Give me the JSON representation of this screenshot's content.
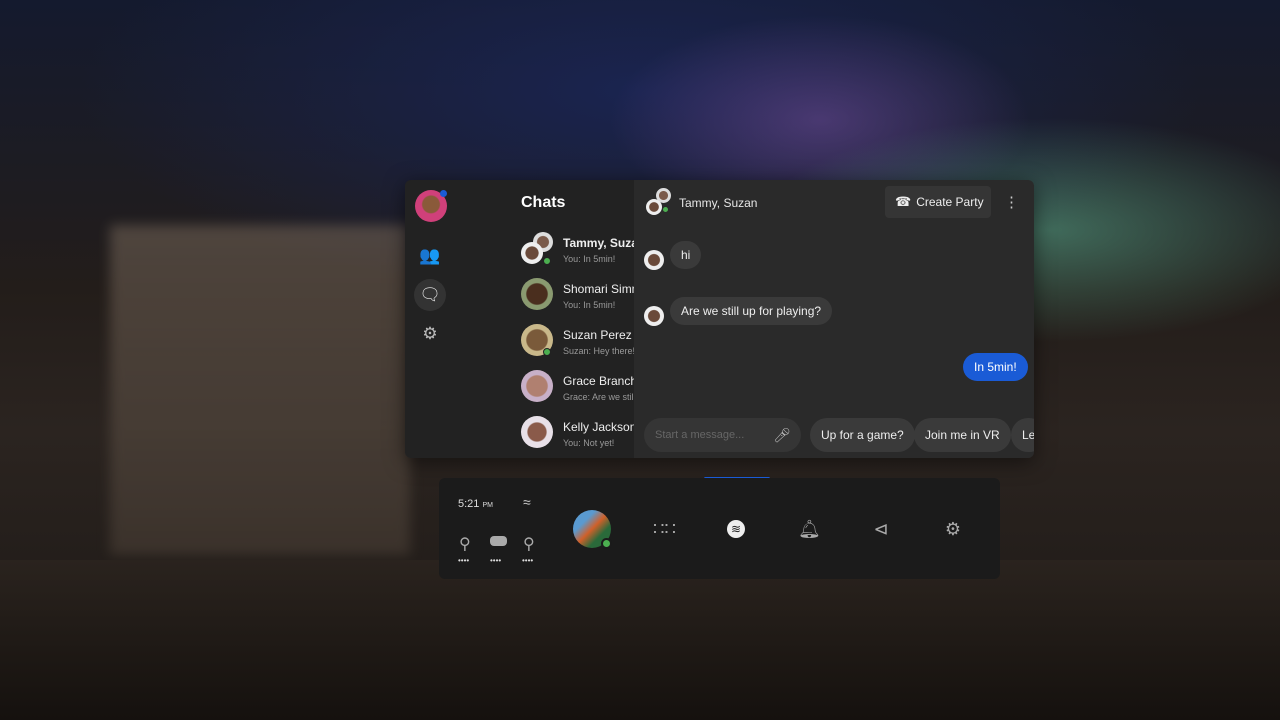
{
  "sidebar": {
    "title": "Chats",
    "icons": [
      "people-icon",
      "chat-icon",
      "gear-icon"
    ]
  },
  "conversations": [
    {
      "name": "Tammy, Suzan",
      "preview": "You: In 5min!",
      "online": true,
      "bold": true
    },
    {
      "name": "Shomari Simm...",
      "preview": "You: In 5min!",
      "online": false
    },
    {
      "name": "Suzan Perez",
      "preview": "Suzan: Hey there!",
      "online": true
    },
    {
      "name": "Grace Branch",
      "preview": "Grace: Are we still u...",
      "online": false,
      "unread": true
    },
    {
      "name": "Kelly Jackson",
      "preview": "You: Not yet!",
      "online": false
    }
  ],
  "chat": {
    "header": "Tammy, Suzan",
    "create_party": "Create Party",
    "messages": [
      {
        "text": "hi",
        "from": "other"
      },
      {
        "text": "Are we still up for playing?",
        "from": "other"
      },
      {
        "text": "In 5min!",
        "from": "me"
      }
    ],
    "input_placeholder": "Start a message...",
    "quick_replies": [
      "Up for a game?",
      "Join me in VR",
      "Le"
    ]
  },
  "taskbar": {
    "time": "5:21",
    "ampm": "PM",
    "battery_dots": "••••",
    "icons": [
      "apps-icon",
      "messenger-icon",
      "bell-icon",
      "share-icon",
      "gear-icon"
    ]
  },
  "colors": {
    "accent": "#1a5bd6",
    "online": "#4caf50"
  }
}
